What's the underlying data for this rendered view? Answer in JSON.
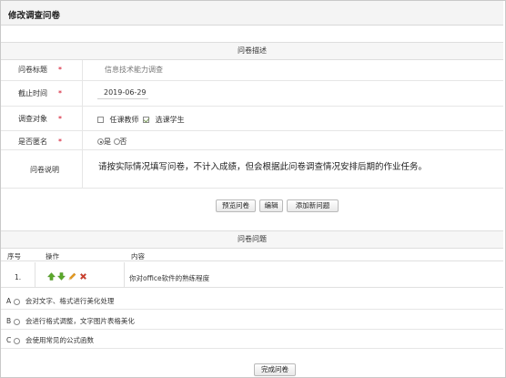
{
  "page": {
    "title": "修改调查问卷"
  },
  "section_description": {
    "title": "问卷描述"
  },
  "form": {
    "title_label": "问卷标题",
    "title_value": "信息技术能力调查",
    "deadline_label": "截止时间",
    "deadline_value": "2019-06-29",
    "target_label": "调查对象",
    "target_options": [
      {
        "label": "任课教师",
        "checked": false
      },
      {
        "label": "选课学生",
        "checked": true
      }
    ],
    "anonymous_label": "是否匿名",
    "anonymous_options": [
      {
        "label": "是",
        "checked": true
      },
      {
        "label": "否",
        "checked": false
      }
    ],
    "note_label": "问卷说明",
    "note_value": "请按实际情况填写问卷，不计入成绩，但会根据此问卷调查情况安排后期的作业任务。",
    "required_mark": "*"
  },
  "actions": {
    "preview_label": "预览问卷",
    "edit_label": "编辑",
    "add_question_label": "添加新问题"
  },
  "section_questions": {
    "title": "问卷问题"
  },
  "questions_table": {
    "headers": {
      "index": "序号",
      "ops": "操作",
      "content": "内容"
    },
    "rows": [
      {
        "index": "1.",
        "content": "你对office软件的熟练程度"
      }
    ],
    "icons": [
      "arrow-up-icon",
      "arrow-down-icon",
      "pencil-icon",
      "delete-icon"
    ],
    "colors": {
      "arrow": "#5aa82a",
      "pencil": "#e69a1f",
      "delete": "#d23c2a",
      "required": "#d0021b"
    }
  },
  "options": [
    {
      "letter": "A",
      "text": "会对文字、格式进行美化处理"
    },
    {
      "letter": "B",
      "text": "会进行格式调整，文字图片表格美化"
    },
    {
      "letter": "C",
      "text": "会使用常见的公式函数"
    }
  ],
  "finish_label": "完成问卷"
}
